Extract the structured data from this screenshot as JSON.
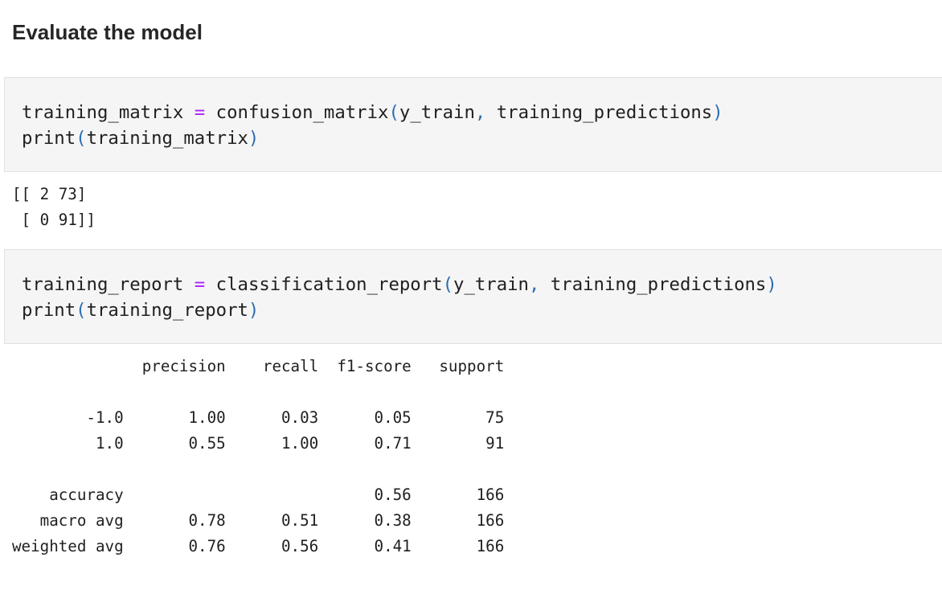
{
  "section": {
    "title": "Evaluate the model"
  },
  "cells": [
    {
      "input": {
        "line1": {
          "var": "training_matrix",
          "op": "=",
          "func": "confusion_matrix",
          "open": "(",
          "arg1": "y_train",
          "comma": ",",
          "arg2": "training_predictions",
          "close": ")"
        },
        "line2": {
          "func": "print",
          "open": "(",
          "arg": "training_matrix",
          "close": ")"
        }
      },
      "output": {
        "lines": [
          "[[ 2 73]",
          " [ 0 91]]"
        ]
      }
    },
    {
      "input": {
        "line1": {
          "var": "training_report",
          "op": "=",
          "func": "classification_report",
          "open": "(",
          "arg1": "y_train",
          "comma": ",",
          "arg2": "training_predictions",
          "close": ")"
        },
        "line2": {
          "func": "print",
          "open": "(",
          "arg": "training_report",
          "close": ")"
        }
      },
      "output": {
        "lines": [
          "              precision    recall  f1-score   support",
          "",
          "        -1.0       1.00      0.03      0.05        75",
          "         1.0       0.55      1.00      0.71        91",
          "",
          "    accuracy                           0.56       166",
          "   macro avg       0.78      0.51      0.38       166",
          "weighted avg       0.76      0.56      0.41       166"
        ]
      }
    }
  ]
}
